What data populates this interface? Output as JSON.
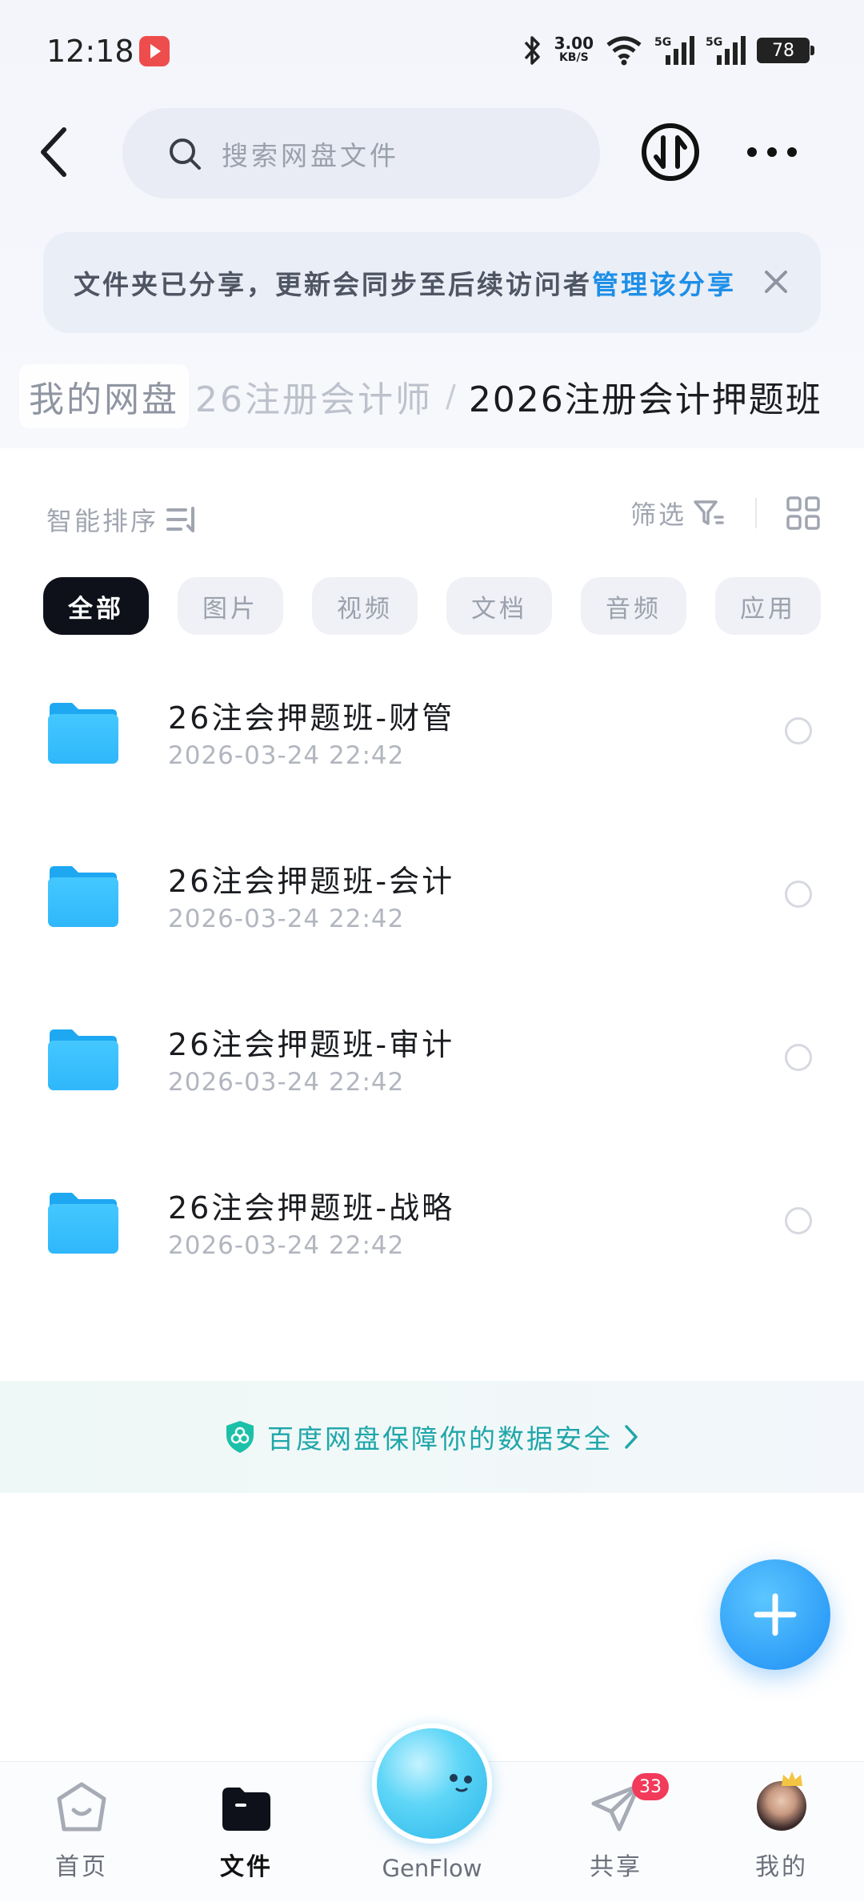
{
  "status_bar": {
    "time": "12:18",
    "net_speed_value": "3.00",
    "net_speed_unit": "KB/S",
    "battery": "78"
  },
  "header": {
    "search_placeholder": "搜索网盘文件"
  },
  "share_banner": {
    "text": "文件夹已分享，更新会同步至后续访问者",
    "link": "管理该分享"
  },
  "breadcrumb": {
    "root": "我的网盘",
    "middle": "26注册会计师",
    "separator": "/",
    "current": "2026注册会计押题班"
  },
  "toolbar": {
    "sort_label": "智能排序",
    "filter_label": "筛选"
  },
  "chips": [
    "全部",
    "图片",
    "视频",
    "文档",
    "音频",
    "应用"
  ],
  "files": [
    {
      "name": "26注会押题班-财管",
      "date": "2026-03-24  22:42"
    },
    {
      "name": "26注会押题班-会计",
      "date": "2026-03-24  22:42"
    },
    {
      "name": "26注会押题班-审计",
      "date": "2026-03-24  22:42"
    },
    {
      "name": "26注会押题班-战略",
      "date": "2026-03-24  22:42"
    }
  ],
  "security": {
    "text": "百度网盘保障你的数据安全"
  },
  "bottom_nav": {
    "home": "首页",
    "files": "文件",
    "genflow": "GenFlow",
    "share": "共享",
    "share_badge": "33",
    "mine": "我的"
  },
  "colors": {
    "accent_blue": "#1d8fe8",
    "security_teal": "#1fa6a9",
    "folder_blue": "#3ec4ff",
    "badge_red": "#f23a5a"
  }
}
